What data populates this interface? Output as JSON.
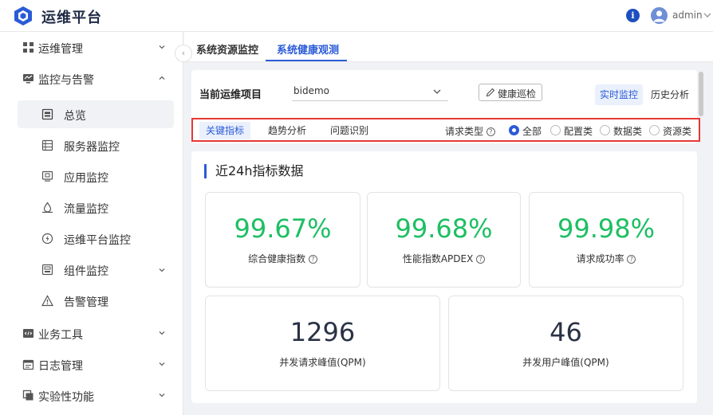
{
  "app": {
    "title": "运维平台"
  },
  "header": {
    "user": "admin",
    "info_icon": "i"
  },
  "sidebar": {
    "items": [
      {
        "label": "运维管理"
      },
      {
        "label": "监控与告警"
      },
      {
        "label": "业务工具"
      },
      {
        "label": "日志管理"
      },
      {
        "label": "实验性功能"
      }
    ],
    "monitor_children": [
      {
        "label": "总览"
      },
      {
        "label": "服务器监控"
      },
      {
        "label": "应用监控"
      },
      {
        "label": "流量监控"
      },
      {
        "label": "运维平台监控"
      },
      {
        "label": "组件监控"
      },
      {
        "label": "告警管理"
      }
    ]
  },
  "page_tabs": [
    {
      "label": "系统资源监控"
    },
    {
      "label": "系统健康观测"
    }
  ],
  "project": {
    "label": "当前运维项目",
    "value": "bidemo",
    "inspect_button": "健康巡检"
  },
  "mode_tabs": [
    {
      "label": "实时监控"
    },
    {
      "label": "历史分析"
    }
  ],
  "key_tabs": [
    {
      "label": "关键指标"
    },
    {
      "label": "趋势分析"
    },
    {
      "label": "问题识别"
    }
  ],
  "request_type": {
    "label": "请求类型",
    "options": [
      {
        "label": "全部"
      },
      {
        "label": "配置类"
      },
      {
        "label": "数据类"
      },
      {
        "label": "资源类"
      }
    ],
    "selected": "全部"
  },
  "section": {
    "title": "近24h指标数据"
  },
  "metrics": [
    {
      "value": "99.67%",
      "label": "综合健康指数"
    },
    {
      "value": "99.68%",
      "label": "性能指数APDEX"
    },
    {
      "value": "99.98%",
      "label": "请求成功率"
    },
    {
      "value": "1296",
      "label": "并发请求峰值(QPM)"
    },
    {
      "value": "46",
      "label": "并发用户峰值(QPM)"
    }
  ],
  "colors": {
    "accent": "#2b5bd7",
    "success": "#1dbf63",
    "highlight_border": "#e53935"
  }
}
